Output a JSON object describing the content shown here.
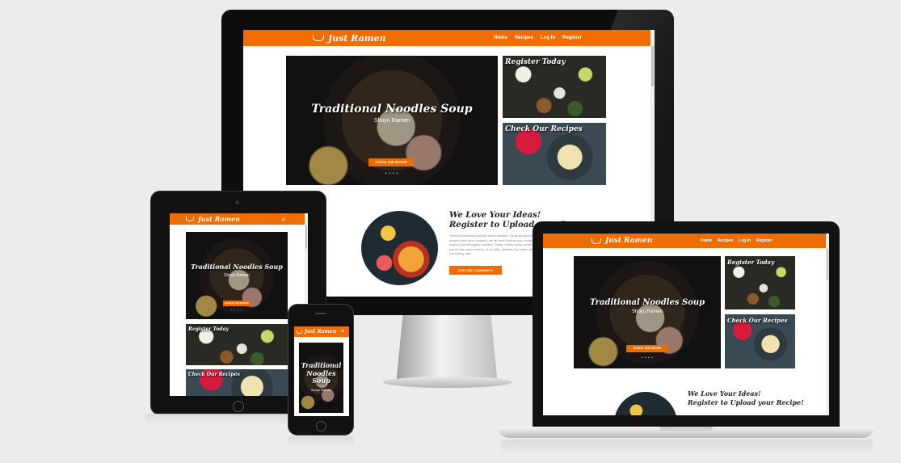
{
  "site": {
    "brand": "Just Ramen",
    "nav": [
      "Home",
      "Recipes",
      "Log In",
      "Register"
    ],
    "menu_icon": "≡",
    "hero": {
      "title": "Traditional Noodles Soup",
      "subtitle": "Shoyu Ramen",
      "button": "CHECK THE RECIPE",
      "dots": "● ● ● ●"
    },
    "tiles": {
      "register": "Register Today",
      "recipes": "Check Our Recipes"
    },
    "community": {
      "line1": "We Love Your Ideas!",
      "line2": "Register to Upload your Recipe!",
      "line2_partial": "Register to Upload your R",
      "paragraph": "There's something special about noodles. Since ancient times people have been cooking, we've been finding new, creative ways to put alongside noodles. Today, nearly every corner of the planet has some version of noodles, whether it's ramen, pho or something else.",
      "button": "JOIN THE COMMUNITY"
    }
  },
  "colors": {
    "brand_orange": "#ef6c00",
    "background": "#ececec"
  },
  "devices": [
    "desktop-monitor",
    "tablet",
    "laptop",
    "phone"
  ]
}
